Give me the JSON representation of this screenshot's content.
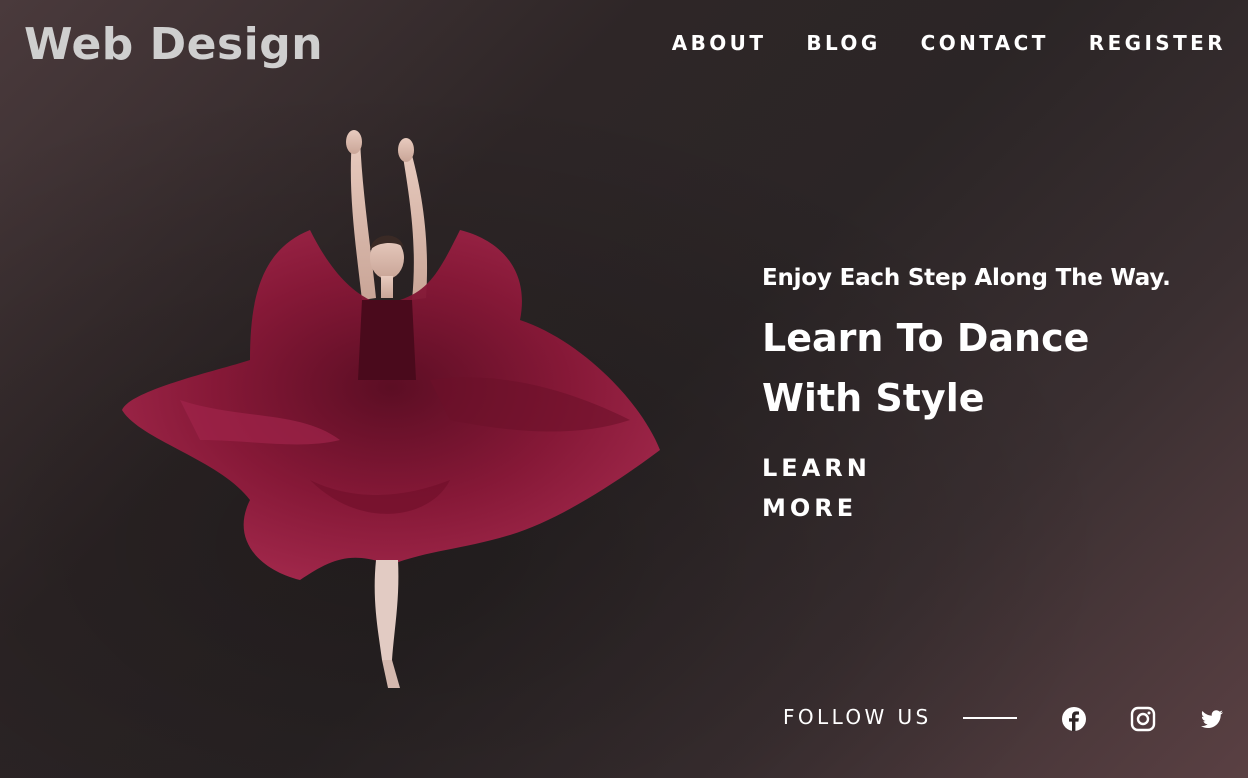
{
  "brand": {
    "logo_text": "Web Design"
  },
  "nav": {
    "items": [
      {
        "label": "ABOUT"
      },
      {
        "label": "BLOG"
      },
      {
        "label": "CONTACT"
      },
      {
        "label": "REGISTER"
      }
    ]
  },
  "hero": {
    "tagline": "Enjoy Each Step Along The Way.",
    "headline": "Learn To Dance With Style",
    "cta_label": "LEARN MORE"
  },
  "social": {
    "follow_label": "FOLLOW US",
    "icons": [
      "facebook-icon",
      "instagram-icon",
      "twitter-icon"
    ]
  },
  "colors": {
    "background_dark": "#2b2526",
    "background_accent": "#5a4043",
    "dress": "#8a1838",
    "text": "#ffffff",
    "logo": "#cfcfcf"
  }
}
